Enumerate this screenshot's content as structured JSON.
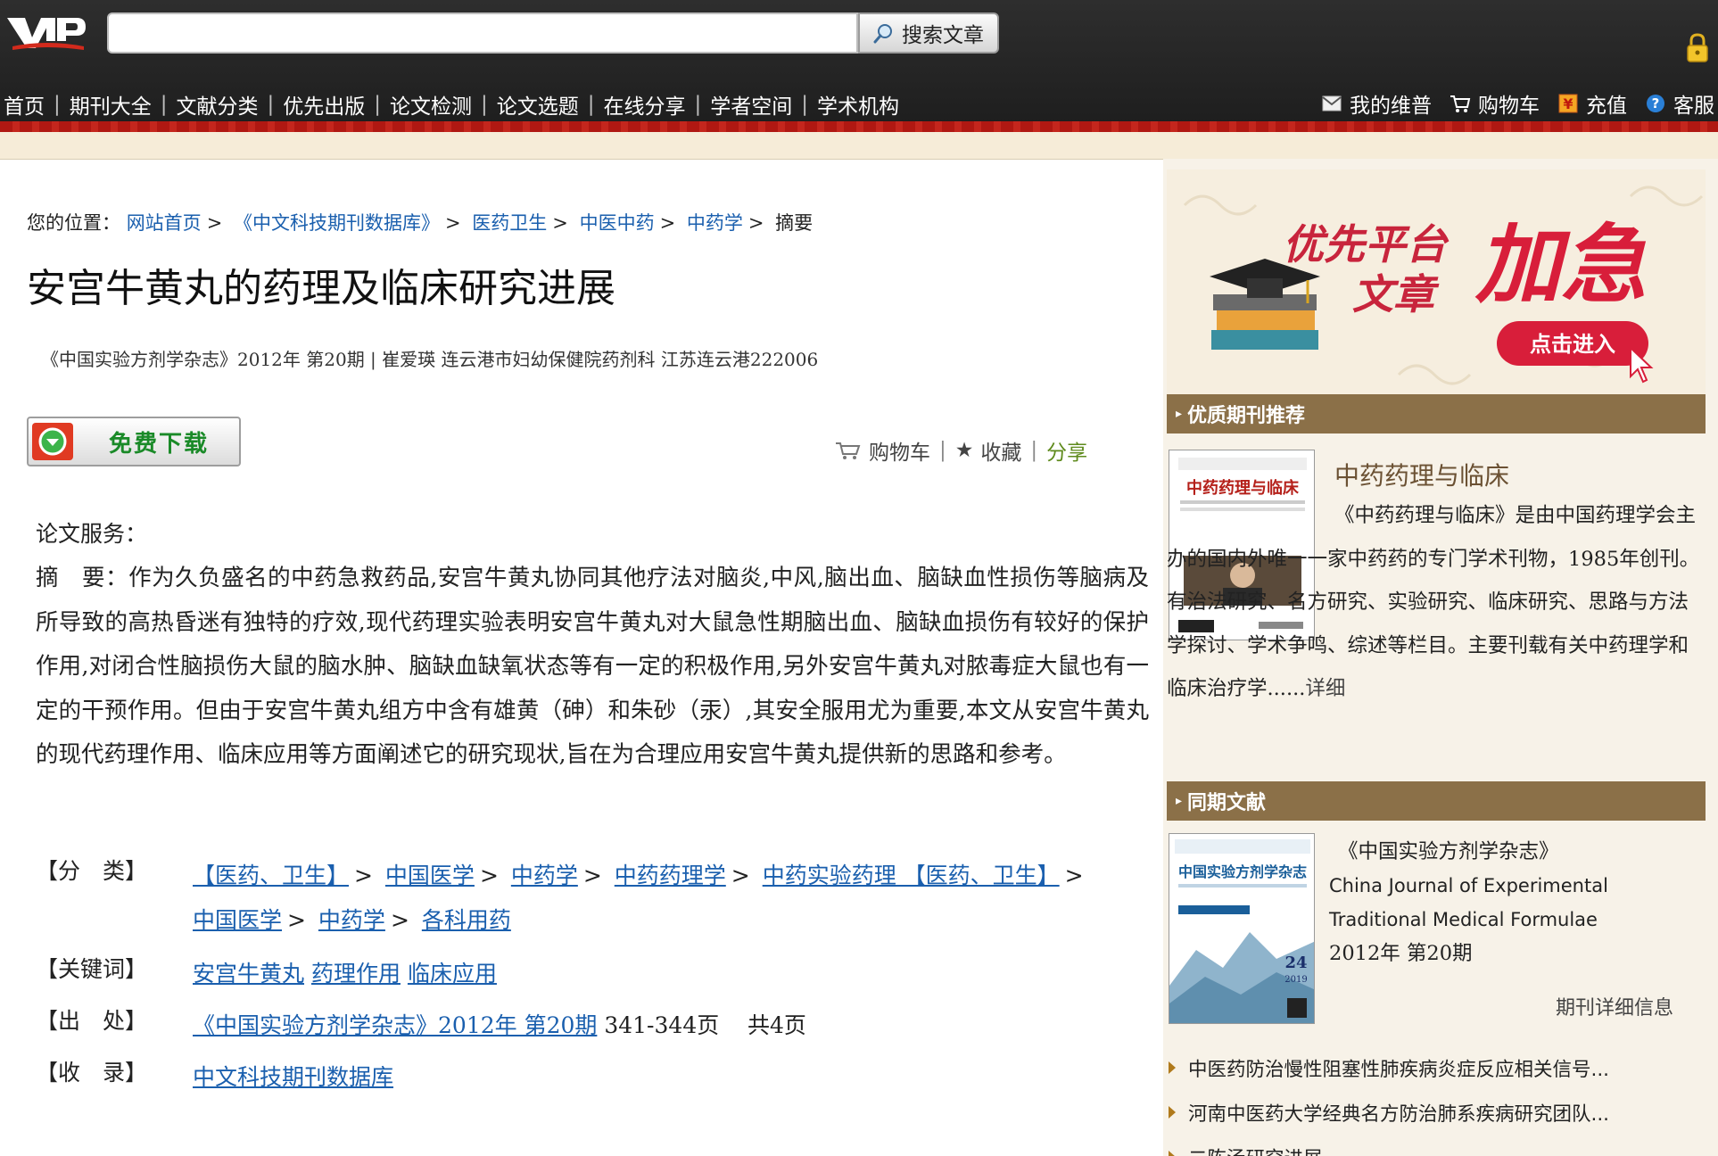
{
  "header": {
    "logo_text": "VIP",
    "search": {
      "value": "",
      "placeholder": "",
      "button_label": "搜索文章"
    },
    "nav": [
      {
        "label": "首页"
      },
      {
        "label": "期刊大全"
      },
      {
        "label": "文献分类"
      },
      {
        "label": "优先出版"
      },
      {
        "label": "论文检测"
      },
      {
        "label": "论文选题"
      },
      {
        "label": "在线分享"
      },
      {
        "label": "学者空间"
      },
      {
        "label": "学术机构"
      }
    ],
    "user_nav": {
      "my_vip": "我的维普",
      "cart": "购物车",
      "recharge": "充值",
      "service": "客服"
    }
  },
  "breadcrumb": {
    "prefix": "您的位置：",
    "items": [
      "网站首页",
      "《中文科技期刊数据库》",
      "医药卫生",
      "中医中药",
      "中药学"
    ],
    "current": "摘要"
  },
  "article": {
    "title": "安宫牛黄丸的药理及临床研究进展",
    "meta": "《中国实验方剂学杂志》2012年 第20期 | 崔爱瑛   连云港市妇幼保健院药剂科 江苏连云港222006",
    "download_label": "免费下载",
    "actions": {
      "cart": "购物车",
      "favorite": "收藏",
      "share": "分享"
    },
    "service_label": "论文服务：",
    "abstract_label": "摘　要：",
    "abstract": "作为久负盛名的中药急救药品,安宫牛黄丸协同其他疗法对脑炎,中风,脑出血、脑缺血性损伤等脑病及所导致的高热昏迷有独特的疗效,现代药理实验表明安宫牛黄丸对大鼠急性期脑出血、脑缺血损伤有较好的保护作用,对闭合性脑损伤大鼠的脑水肿、脑缺血缺氧状态等有一定的积极作用,另外安宫牛黄丸对脓毒症大鼠也有一定的干预作用。但由于安宫牛黄丸组方中含有雄黄（砷）和朱砂（汞）,其安全服用尤为重要,本文从安宫牛黄丸的现代药理作用、临床应用等方面阐述它的研究现状,旨在为合理应用安宫牛黄丸提供新的思路和参考。",
    "classification": {
      "label": "【分　类】",
      "path1": [
        "【医药、卫生】",
        "中国医学",
        "中药学",
        "中药药理学",
        "中药实验药理 【医药、卫生】"
      ],
      "path2": [
        "中国医学",
        "中药学",
        "各科用药"
      ]
    },
    "keywords": {
      "label": "【关键词】",
      "items": [
        "安宫牛黄丸",
        "药理作用",
        "临床应用"
      ]
    },
    "source": {
      "label": "【出　处】",
      "link": "《中国实验方剂学杂志》2012年 第20期",
      "pages": "341-344页",
      "total": "共4页"
    },
    "included": {
      "label": "【收　录】",
      "link": "中文科技期刊数据库"
    }
  },
  "sidebar": {
    "banner": {
      "line1": "优先平台",
      "line2": "文章",
      "big": "加急",
      "button": "点击进入"
    },
    "recommend": {
      "heading": "优质期刊推荐",
      "cover_title": "中药药理与临床",
      "title": "中药药理与临床",
      "description": "《中药药理与临床》是由中国药理学会主办的国内外唯一一家中药药的专门学术刊物，1985年创刊。有治法研究、名方研究、实验研究、临床研究、思路与方法学探讨、学术争鸣、综述等栏目。主要刊载有关中药理学和临床治疗学......",
      "more": "详细"
    },
    "issue": {
      "heading": "同期文献",
      "cover_title": "中国实验方剂学杂志",
      "cover_issue": "24",
      "cover_year": "2019",
      "journal_cn": "《中国实验方剂学杂志》",
      "journal_en": "China Journal of Experimental Traditional Medical Formulae",
      "issue_text": "2012年 第20期",
      "detail_link": "期刊详细信息"
    },
    "related": [
      "中医药防治慢性阻塞性肺疾病炎症反应相关信号...",
      "河南中医药大学经典名方防治肺系疾病研究团队...",
      "二陈汤研究进展"
    ]
  }
}
